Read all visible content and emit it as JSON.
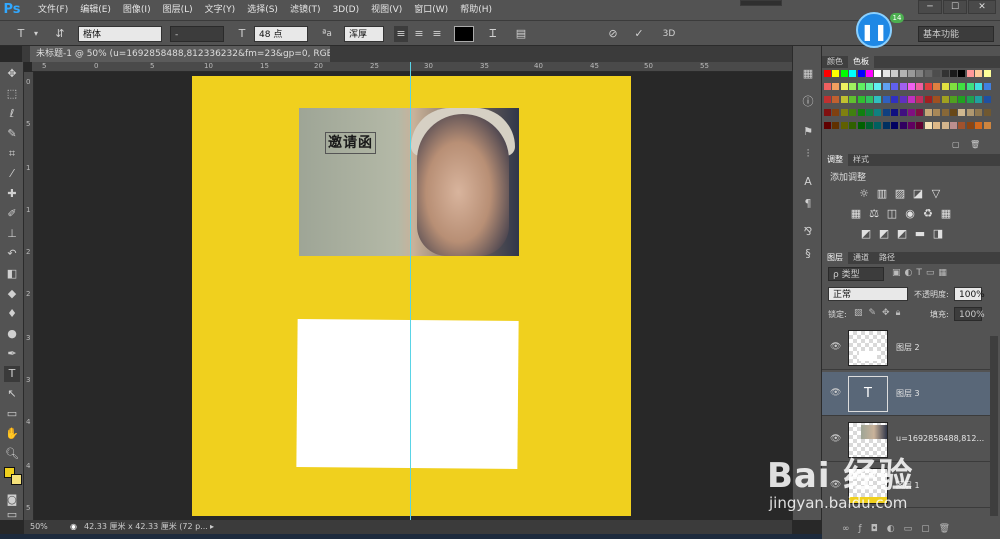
{
  "app": {
    "logo": "Ps"
  },
  "menubar": {
    "items": [
      "文件(F)",
      "编辑(E)",
      "图像(I)",
      "图层(L)",
      "文字(Y)",
      "选择(S)",
      "滤镜(T)",
      "3D(D)",
      "视图(V)",
      "窗口(W)",
      "帮助(H)"
    ]
  },
  "options": {
    "font_family": "楷体",
    "font_style": "-",
    "font_size": "48 点",
    "aa_label": "ªa",
    "aa_method": "浑厚",
    "three_d": "3D",
    "workspace": "基本功能"
  },
  "document": {
    "tab_title": "未标题-1 @ 50% (u=1692858488,812336232&fm=23&gp=0, RGB/8) *",
    "title_text": "邀请函",
    "bg_color": "#f0d01e"
  },
  "rulers": {
    "h_ticks": [
      "5",
      "0",
      "5",
      "10",
      "15",
      "20",
      "25",
      "30",
      "35",
      "40",
      "45",
      "50",
      "55"
    ],
    "v_ticks": [
      "0",
      "5",
      "1",
      "1",
      "2",
      "2",
      "3",
      "3",
      "4",
      "4",
      "5"
    ]
  },
  "status": {
    "zoom": "50%",
    "doc_size": "42.33 厘米 x 42.33 厘米 (72 p..."
  },
  "panels": {
    "color_tabs": [
      "颜色",
      "色板"
    ],
    "adjust_tabs": [
      "调整",
      "样式"
    ],
    "adjust_title": "添加调整",
    "layer_tabs": [
      "图层",
      "通道",
      "路径"
    ],
    "kind_label": "ρ 类型",
    "blend_mode": "正常",
    "opacity_label": "不透明度:",
    "opacity_value": "100%",
    "lock_label": "锁定:",
    "fill_label": "填充:",
    "fill_value": "100%",
    "layers": [
      {
        "name": "图层 2",
        "type": "pixel"
      },
      {
        "name": "图层 3",
        "type": "text"
      },
      {
        "name": "u=1692858488,812...",
        "type": "photo"
      },
      {
        "name": "图层 1",
        "type": "pixel"
      }
    ]
  },
  "overlay": {
    "badge_num": "14",
    "watermark_top": "Bai 经验",
    "watermark_url": "jingyan.baidu.com"
  }
}
